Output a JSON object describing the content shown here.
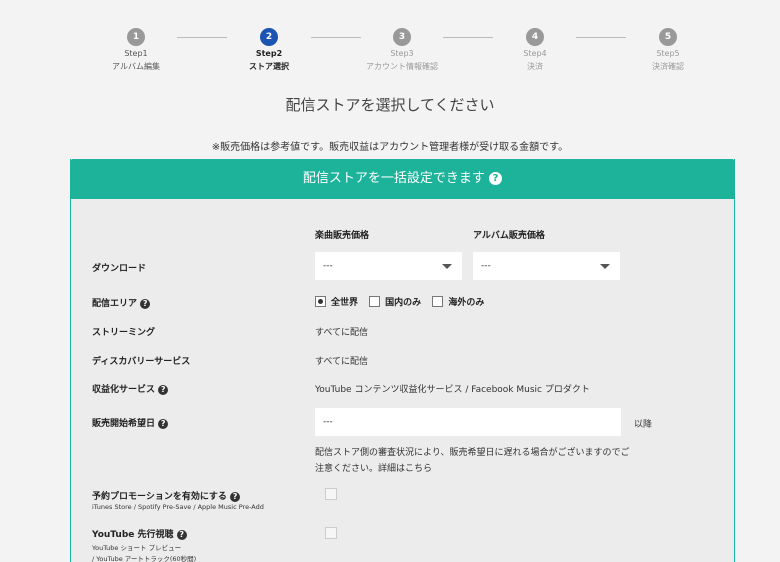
{
  "stepper": [
    {
      "num": "1",
      "step": "Step1",
      "label": "アルバム編集",
      "state": "done"
    },
    {
      "num": "2",
      "step": "Step2",
      "label": "ストア選択",
      "state": "active"
    },
    {
      "num": "3",
      "step": "Step3",
      "label": "アカウント情報確認",
      "state": "pending"
    },
    {
      "num": "4",
      "step": "Step4",
      "label": "決済",
      "state": "pending"
    },
    {
      "num": "5",
      "step": "Step5",
      "label": "決済確認",
      "state": "pending"
    }
  ],
  "page_title": "配信ストアを選択してください",
  "notice": "※販売価格は参考値です。販売収益はアカウント管理者様が受け取る金額です。",
  "panel": {
    "header": "配信ストアを一括設定できます",
    "help_glyph": "?",
    "col_song_price": "楽曲販売価格",
    "col_album_price": "アルバム販売価格",
    "download_label": "ダウンロード",
    "song_price_value": "---",
    "album_price_value": "---",
    "area_label": "配信エリア",
    "area_options": [
      "全世界",
      "国内のみ",
      "海外のみ"
    ],
    "area_selected": "全世界",
    "streaming_label": "ストリーミング",
    "streaming_value": "すべてに配信",
    "discovery_label": "ディスカバリーサービス",
    "discovery_value": "すべてに配信",
    "monetize_label": "収益化サービス",
    "monetize_value": "YouTube コンテンツ収益化サービス / Facebook Music プロダクト",
    "start_date_label": "販売開始希望日",
    "start_date_value": "---",
    "start_date_suffix": "以降",
    "start_date_note": "配信ストア側の審査状況により、販売希望日に遅れる場合がございますのでご注意ください。詳細はこちら",
    "promo_label": "予約プロモーションを有効にする",
    "promo_sub": "iTunes Store / Spotify Pre-Save / Apple Music Pre-Add",
    "youtube_label": "YouTube 先行視聴",
    "youtube_sub1": "YouTube ショート プレビュー",
    "youtube_sub2": "/ YouTube アートトラック(60秒間)"
  },
  "colors": {
    "accent": "#1db39b",
    "active_step": "#1c54b2"
  }
}
